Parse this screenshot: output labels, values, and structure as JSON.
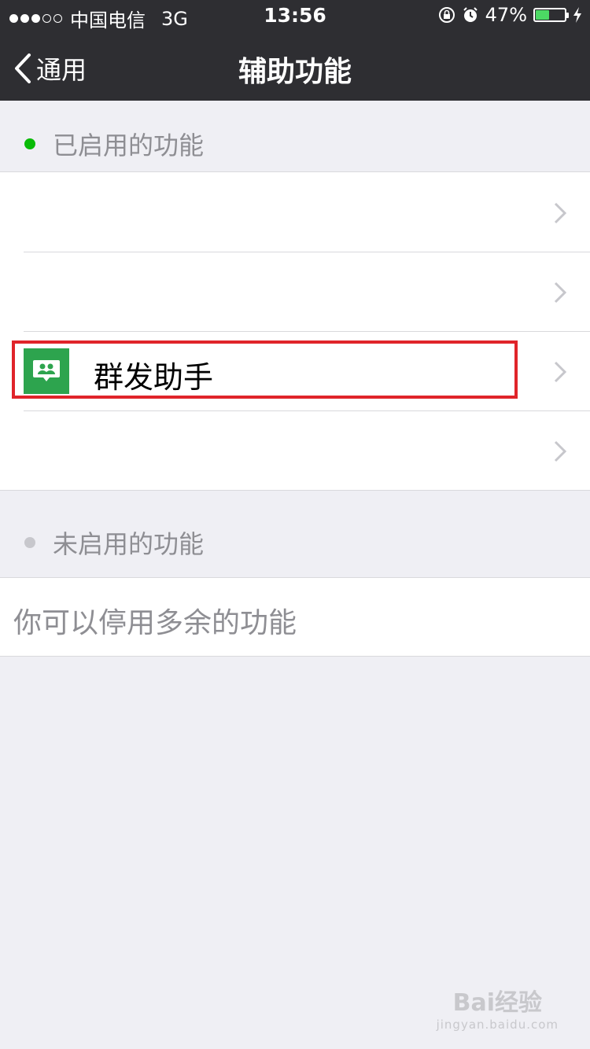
{
  "statusbar": {
    "carrier": "中国电信",
    "network": "3G",
    "time": "13:56",
    "battery_percent_text": "47%",
    "battery_level": 0.47
  },
  "navbar": {
    "back_label": "通用",
    "title": "辅助功能"
  },
  "enabled_section": {
    "header": "已启用的功能",
    "bullet_color": "#09bb07",
    "items": [
      {
        "label": ""
      },
      {
        "label": ""
      },
      {
        "label": "群发助手",
        "icon": "group-message-icon",
        "icon_color": "#2da44e"
      },
      {
        "label": ""
      }
    ]
  },
  "disabled_section": {
    "header": "未启用的功能",
    "bullet_color": "#c7c7cc",
    "hint": "你可以停用多余的功能"
  },
  "watermark": {
    "brand": "Bai经验",
    "url": "jingyan.baidu.com"
  }
}
